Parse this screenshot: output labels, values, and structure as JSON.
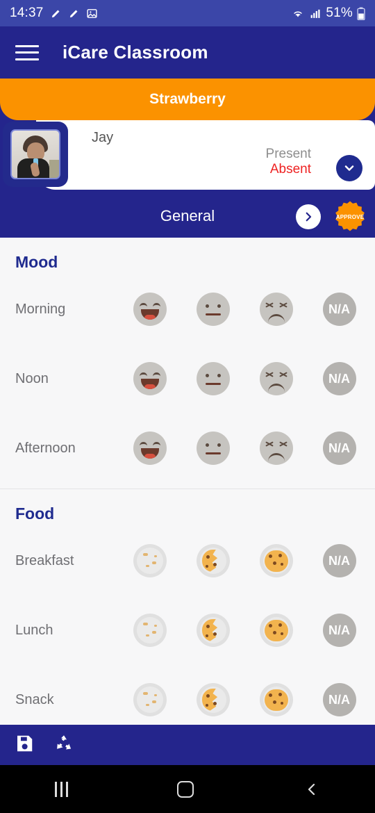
{
  "status_bar": {
    "time": "14:37",
    "battery_pct": "51%",
    "icons": [
      "pencil-icon",
      "pencil-icon",
      "image-icon",
      "wifi-icon",
      "signal-icon",
      "battery-icon"
    ]
  },
  "app_bar": {
    "menu_icon": "hamburger-menu-icon",
    "title": "iCare Classroom"
  },
  "class_banner": {
    "name": "Strawberry",
    "color": "#fb9200"
  },
  "student": {
    "name": "Jay",
    "attendance_present": "Present",
    "attendance_absent": "Absent",
    "selected_status": "Absent",
    "present_color": "#8e8e8e",
    "absent_color": "#ee2222",
    "expand_icon": "chevron-down-icon",
    "avatar": "student-photo"
  },
  "tab_bar": {
    "current_tab": "General",
    "next_icon": "chevron-right-icon",
    "approve_label": "APPROVE",
    "approve_color": "#fb9200"
  },
  "sections": [
    {
      "title": "Mood",
      "rows": [
        {
          "label": "Morning",
          "options": [
            "happy-face-icon",
            "neutral-face-icon",
            "sad-face-icon",
            "N/A"
          ]
        },
        {
          "label": "Noon",
          "options": [
            "happy-face-icon",
            "neutral-face-icon",
            "sad-face-icon",
            "N/A"
          ]
        },
        {
          "label": "Afternoon",
          "options": [
            "happy-face-icon",
            "neutral-face-icon",
            "sad-face-icon",
            "N/A"
          ]
        }
      ]
    },
    {
      "title": "Food",
      "rows": [
        {
          "label": "Breakfast",
          "options": [
            "empty-plate-icon",
            "half-cookie-icon",
            "full-cookie-icon",
            "N/A"
          ]
        },
        {
          "label": "Lunch",
          "options": [
            "empty-plate-icon",
            "half-cookie-icon",
            "full-cookie-icon",
            "N/A"
          ]
        },
        {
          "label": "Snack",
          "options": [
            "empty-plate-icon",
            "half-cookie-icon",
            "full-cookie-icon",
            "N/A"
          ]
        }
      ]
    }
  ],
  "bottom_bar": {
    "save_icon": "save-floppy-icon",
    "refresh_icon": "refresh-recycle-icon"
  },
  "nav_bar": {
    "recents_icon": "recents-icon",
    "home_icon": "home-icon",
    "back_icon": "back-icon"
  },
  "na_label": "N/A",
  "theme": {
    "primary_navy": "#24258c",
    "status_navy": "#3b46a8",
    "accent_orange": "#fb9200",
    "page_bg": "#f7f7f8"
  }
}
